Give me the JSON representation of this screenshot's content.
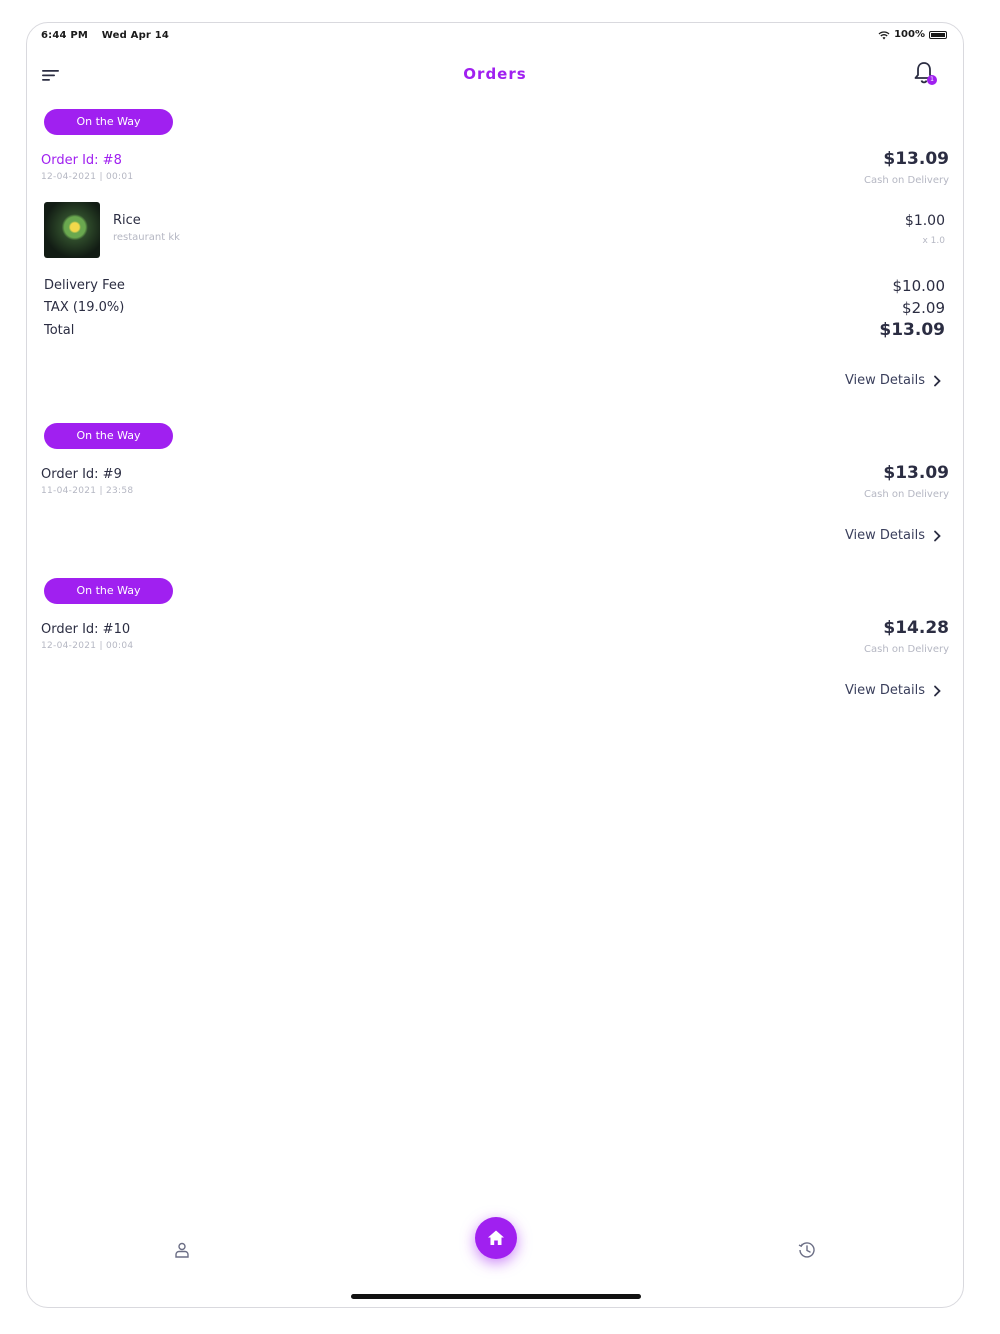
{
  "status_bar": {
    "time": "6:44 PM",
    "date": "Wed Apr 14",
    "battery": "100%"
  },
  "header": {
    "title": "Orders",
    "notification_count": "1"
  },
  "orders": [
    {
      "status": "On the Way",
      "order_id": "Order Id: #8",
      "date": "12-04-2021 | 00:01",
      "total": "$13.09",
      "payment": "Cash on Delivery",
      "items": [
        {
          "name": "Rice",
          "restaurant": "restaurant kk",
          "price": "$1.00",
          "qty": "x 1.0"
        }
      ],
      "fees": [
        {
          "label": "Delivery Fee",
          "value": "$10.00"
        },
        {
          "label": "TAX (19.0%)",
          "value": "$2.09"
        },
        {
          "label": "Total",
          "value": "$13.09"
        }
      ],
      "view_details": "View Details"
    },
    {
      "status": "On the Way",
      "order_id": "Order Id: #9",
      "date": "11-04-2021 | 23:58",
      "total": "$13.09",
      "payment": "Cash on Delivery",
      "view_details": "View Details"
    },
    {
      "status": "On the Way",
      "order_id": "Order Id: #10",
      "date": "12-04-2021 | 00:04",
      "total": "$14.28",
      "payment": "Cash on Delivery",
      "view_details": "View Details"
    }
  ],
  "bottom_nav": {
    "items": [
      "profile-icon",
      "home-icon",
      "history-icon"
    ]
  },
  "colors": {
    "accent": "#a020f0",
    "text": "#2b2d42",
    "muted": "#b5b7c3"
  }
}
